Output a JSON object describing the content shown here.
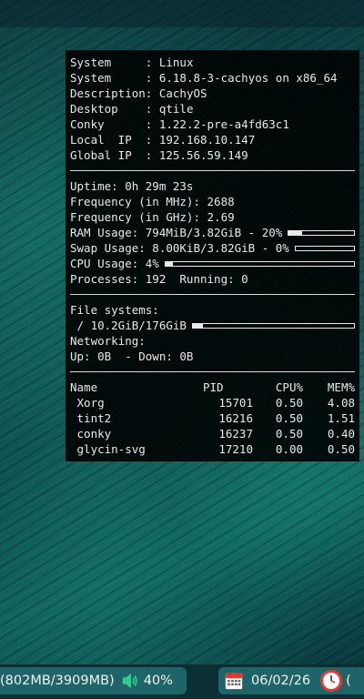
{
  "conky": {
    "system_info": [
      {
        "label": "System     ",
        "value": "Linux"
      },
      {
        "label": "System     ",
        "value": "6.18.8-3-cachyos on x86_64"
      },
      {
        "label": "Description",
        "value": "CachyOS"
      },
      {
        "label": "Desktop    ",
        "value": "qtile"
      },
      {
        "label": "Conky      ",
        "value": "1.22.2-pre-a4fd63c1"
      },
      {
        "label": "Local  IP  ",
        "value": "192.168.10.147"
      },
      {
        "label": "Global IP  ",
        "value": "125.56.59.149"
      }
    ],
    "uptime": "Uptime: 0h 29m 23s",
    "freq_mhz": "Frequency (in MHz): 2688",
    "freq_ghz": "Frequency (in GHz): 2.69",
    "ram_usage": "RAM Usage: 794MiB/3.82GiB - 20%",
    "ram_fraction": 0.2,
    "swap_usage": "Swap Usage: 8.00KiB/3.82GiB - 0%",
    "swap_fraction": 0.0,
    "cpu_usage": "CPU Usage: 4%",
    "cpu_fraction": 0.04,
    "processes": "Processes: 192  Running: 0",
    "fs_title": "File systems:",
    "fs_root": " / 10.2GiB/176GiB",
    "fs_fraction": 0.06,
    "net_title": "Networking:",
    "net_updown": "Up: 0B  - Down: 0B",
    "proc_headers": {
      "name": "Name",
      "pid": "PID",
      "cpu": "CPU%",
      "mem": "MEM%"
    },
    "procs": [
      {
        "name": " Xorg",
        "pid": "15701",
        "cpu": "0.50",
        "mem": "4.08"
      },
      {
        "name": " tint2",
        "pid": "16216",
        "cpu": "0.50",
        "mem": "1.51"
      },
      {
        "name": " conky",
        "pid": "16237",
        "cpu": "0.50",
        "mem": "0.40"
      },
      {
        "name": " glycin-svg",
        "pid": "17210",
        "cpu": "0.00",
        "mem": "0.50"
      }
    ]
  },
  "taskbar": {
    "memory": "(802MB/3909MB)",
    "volume": "40%",
    "date": "06/02/26",
    "trail": "(",
    "icons": {
      "volume": "speaker-icon",
      "calendar": "calendar-icon",
      "clock": "clock-icon"
    }
  }
}
